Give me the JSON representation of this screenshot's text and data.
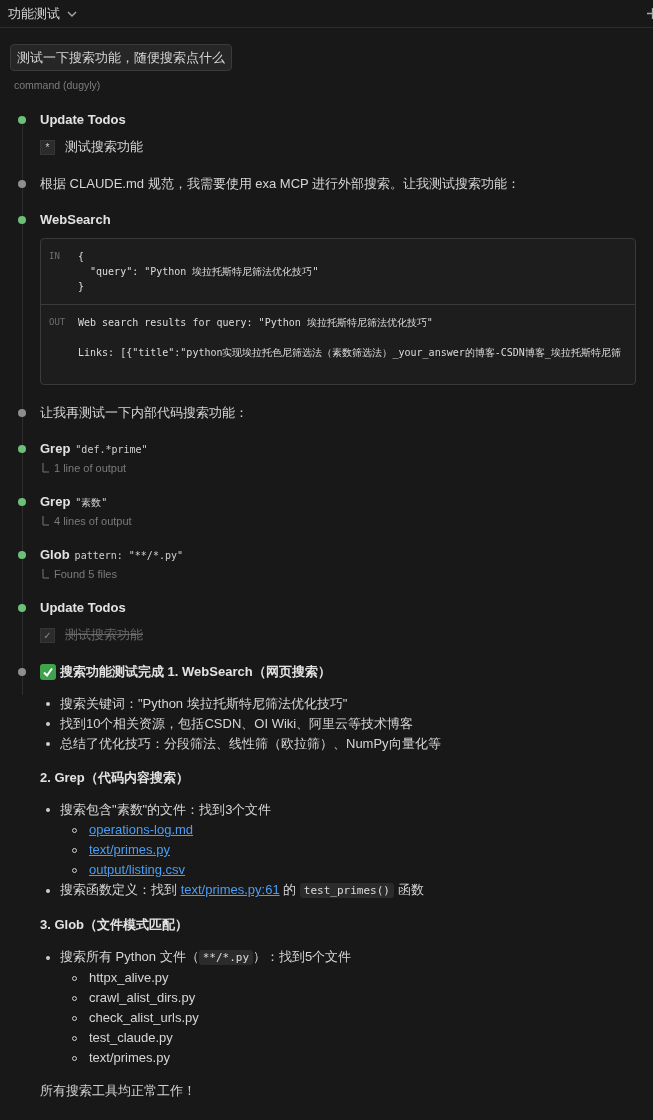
{
  "header": {
    "title": "功能测试"
  },
  "user_message": {
    "text": "测试一下搜索功能，随便搜索点什么",
    "caption": "command (dugyly)"
  },
  "steps": [
    {
      "kind": "todos",
      "color": "#6cbf78",
      "title": "Update Todos",
      "todos": [
        {
          "mark": "*",
          "text": "测试搜索功能",
          "checked": false
        }
      ]
    },
    {
      "kind": "text",
      "color": "#8e8e8e",
      "text": "根据 CLAUDE.md 规范，我需要使用 exa MCP 进行外部搜索。让我测试搜索功能："
    },
    {
      "kind": "io",
      "color": "#6cbf78",
      "title": "WebSearch",
      "sections": [
        {
          "label": "IN",
          "blocks": [
            "{\n  \"query\": \"Python 埃拉托斯特尼筛法优化技巧\"\n}"
          ]
        },
        {
          "label": "OUT",
          "blocks": [
            "Web search results for query: \"Python 埃拉托斯特尼筛法优化技巧\"",
            "Links: [{\"title\":\"python实现埃拉托色尼筛选法（素数筛选法）_your_answer的博客-CSDN博客_埃拉托斯特尼筛"
          ]
        }
      ]
    },
    {
      "kind": "text",
      "color": "#8e8e8e",
      "text": "让我再测试一下内部代码搜索功能："
    },
    {
      "kind": "tool",
      "color": "#6cbf78",
      "title": "Grep",
      "arg": "\"def.*prime\"",
      "result": "1 line of output"
    },
    {
      "kind": "tool",
      "color": "#6cbf78",
      "title": "Grep",
      "arg": "\"素数\"",
      "result": "4 lines of output"
    },
    {
      "kind": "tool",
      "color": "#6cbf78",
      "title": "Glob",
      "arg": "pattern: \"**/*.py\"",
      "result": "Found 5 files"
    },
    {
      "kind": "todos",
      "color": "#6cbf78",
      "title": "Update Todos",
      "todos": [
        {
          "mark": "✓",
          "text": "测试搜索功能",
          "checked": true
        }
      ]
    },
    {
      "kind": "summary",
      "color": "#8e8e8e",
      "heading": "搜索功能测试完成 1. WebSearch（网页搜索）",
      "blocks": [
        {
          "kind": "list",
          "items": [
            {
              "parts": [
                {
                  "kind": "text",
                  "text": "搜索关键词：\"Python 埃拉托斯特尼筛法优化技巧\""
                }
              ]
            },
            {
              "parts": [
                {
                  "kind": "text",
                  "text": "找到10个相关资源，包括CSDN、OI Wiki、阿里云等技术博客"
                }
              ]
            },
            {
              "parts": [
                {
                  "kind": "text",
                  "text": "总结了优化技巧：分段筛法、线性筛（欧拉筛）、NumPy向量化等"
                }
              ]
            }
          ]
        },
        {
          "kind": "heading",
          "text": "2. Grep（代码内容搜索）"
        },
        {
          "kind": "list",
          "items": [
            {
              "parts": [
                {
                  "kind": "text",
                  "text": "搜索包含\"素数\"的文件：找到3个文件"
                }
              ],
              "children": [
                {
                  "kind": "link",
                  "text": "operations-log.md"
                },
                {
                  "kind": "link",
                  "text": "text/primes.py"
                },
                {
                  "kind": "link",
                  "text": "output/listing.csv"
                }
              ]
            },
            {
              "parts": [
                {
                  "kind": "text",
                  "text": "搜索函数定义：找到 "
                },
                {
                  "kind": "link",
                  "text": "text/primes.py:61"
                },
                {
                  "kind": "text",
                  "text": " 的 "
                },
                {
                  "kind": "code",
                  "text": "test_primes()"
                },
                {
                  "kind": "text",
                  "text": " 函数"
                }
              ]
            }
          ]
        },
        {
          "kind": "heading",
          "text": "3. Glob（文件模式匹配）"
        },
        {
          "kind": "list",
          "items": [
            {
              "parts": [
                {
                  "kind": "text",
                  "text": "搜索所有 Python 文件（"
                },
                {
                  "kind": "code",
                  "text": "**/*.py"
                },
                {
                  "kind": "text",
                  "text": "）：找到5个文件"
                }
              ],
              "children": [
                {
                  "kind": "text",
                  "text": "httpx_alive.py"
                },
                {
                  "kind": "text",
                  "text": "crawl_alist_dirs.py"
                },
                {
                  "kind": "text",
                  "text": "check_alist_urls.py"
                },
                {
                  "kind": "text",
                  "text": "test_claude.py"
                },
                {
                  "kind": "text",
                  "text": "text/primes.py"
                }
              ]
            }
          ]
        },
        {
          "kind": "paragraph",
          "text": "所有搜索工具均正常工作！"
        }
      ]
    }
  ]
}
